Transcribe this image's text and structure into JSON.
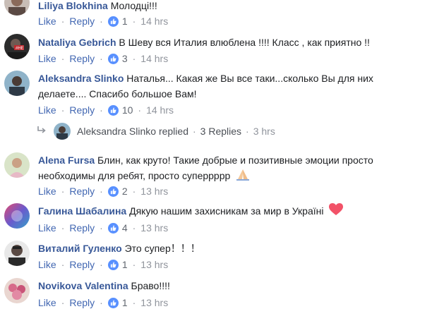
{
  "colors": {
    "name_link": "#385898",
    "action_link": "#4267b2",
    "like_badge": "#5890ff",
    "meta_text": "#90949c",
    "heart": "#f25268"
  },
  "action_labels": {
    "like": "Like",
    "reply": "Reply",
    "separator": "·"
  },
  "comments": [
    {
      "author": "Liliya Blokhina",
      "text": "Молодці!!!",
      "likes": "1",
      "time": "14 hrs",
      "avatar_icon": "avatar-photo"
    },
    {
      "author": "Nataliya Gebrich",
      "text": "В Шеву вся Италия влюблена !!!! Класс , как приятно !!",
      "likes": "3",
      "time": "14 hrs",
      "avatar_icon": "avatar-photo"
    },
    {
      "author": "Aleksandra Slinko",
      "text_line1": "Наталья... Какая же Вы все таки...сколько Вы для них",
      "text_line2": "делаете.... Спасибо большое Вам!",
      "likes": "10",
      "time": "14 hrs",
      "avatar_icon": "avatar-photo"
    },
    {
      "author": "Alena Fursa",
      "text_line1": "Блин, как круто! Такие добрые и позитивные эмоции просто",
      "text_line2": "необходимы для ребят, просто суперрррр",
      "emoji": "folded-hands-emoji",
      "likes": "2",
      "time": "13 hrs",
      "avatar_icon": "avatar-photo"
    },
    {
      "author": "Галина Шабалина",
      "text": "Дякую нашим захисникам за мир в Україні",
      "emoji": "heart-emoji",
      "likes": "4",
      "time": "13 hrs",
      "avatar_icon": "avatar-photo"
    },
    {
      "author": "Виталий Гуленко",
      "text": "Это супер！！！",
      "likes": "1",
      "time": "13 hrs",
      "avatar_icon": "avatar-photo"
    },
    {
      "author": "Novikova Valentina",
      "text": "Браво!!!!",
      "likes": "1",
      "time": "13 hrs",
      "avatar_icon": "avatar-photo"
    }
  ],
  "reply_summary": {
    "icon": "reply-arrow-icon",
    "author_text": "Aleksandra Slinko replied",
    "replies_text": "3 Replies",
    "time": "3 hrs"
  }
}
